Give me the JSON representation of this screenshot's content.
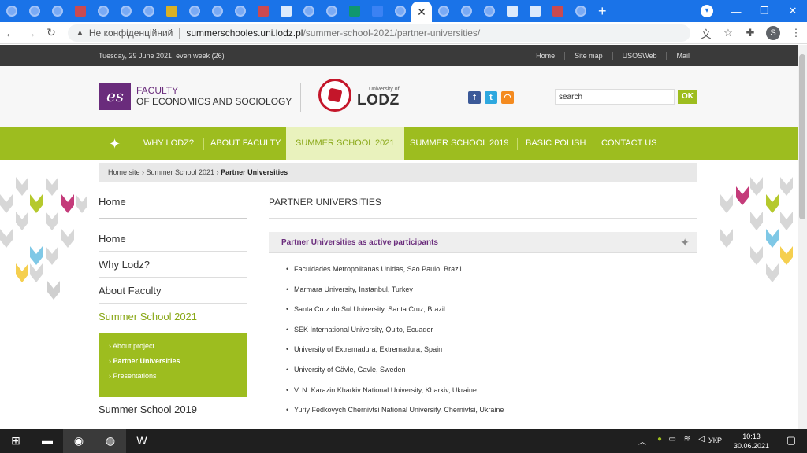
{
  "browser": {
    "security_label": "Не конфіденційний",
    "url_host": "summerschooles.uni.lodz.pl",
    "url_path": "/summer-school-2021/partner-universities/",
    "profile_initial": "S"
  },
  "topbar": {
    "date": "Tuesday, 29 June 2021, even week (26)",
    "links": [
      "Home",
      "Site map",
      "USOSWeb",
      "Mail"
    ]
  },
  "header": {
    "es_logo": "es",
    "faculty_line1": "FACULTY",
    "faculty_line2": "OF ECONOMICS AND SOCIOLOGY",
    "lodz_sub": "University of",
    "lodz_name": "LODZ",
    "search_value": "search",
    "ok_label": "OK"
  },
  "nav": {
    "items": [
      "WHY LODZ?",
      "ABOUT FACULTY",
      "SUMMER SCHOOL 2021",
      "SUMMER SCHOOL 2019",
      "BASIC POLISH",
      "CONTACT US"
    ]
  },
  "breadcrumb": {
    "home": "Home site",
    "parent": "Summer School 2021",
    "current": "Partner Universities"
  },
  "sidebar": {
    "title": "Home",
    "items": [
      "Home",
      "Why Lodz?",
      "About Faculty",
      "Summer School 2021",
      "Summer School 2019"
    ],
    "subitems": [
      "About project",
      "Partner Universities",
      "Presentations"
    ]
  },
  "main": {
    "title": "PARTNER UNIVERSITIES",
    "section_title": "Partner Universities as active participants",
    "universities": [
      "Faculdades Metropolitanas Unidas, Sao Paulo, Brazil",
      "Marmara University, Instanbul, Turkey",
      "Santa Cruz do Sul University, Santa Cruz, Brazil",
      "SEK International University, Quito, Ecuador",
      "University of Extremadura, Extremadura, Spain",
      "University of Gävle, Gavle, Sweden",
      "V. N. Karazin Kharkiv National University, Kharkiv, Ukraine",
      "Yuriy Fedkovych Chernivtsi National University, Chernivtsi, Ukraine"
    ]
  },
  "taskbar": {
    "lang": "УКР",
    "time": "10:13",
    "date": "30.06.2021"
  },
  "colors": {
    "brand_green": "#9dbd1f",
    "brand_purple": "#6a2c7c",
    "chrome_blue": "#1a73e8"
  }
}
